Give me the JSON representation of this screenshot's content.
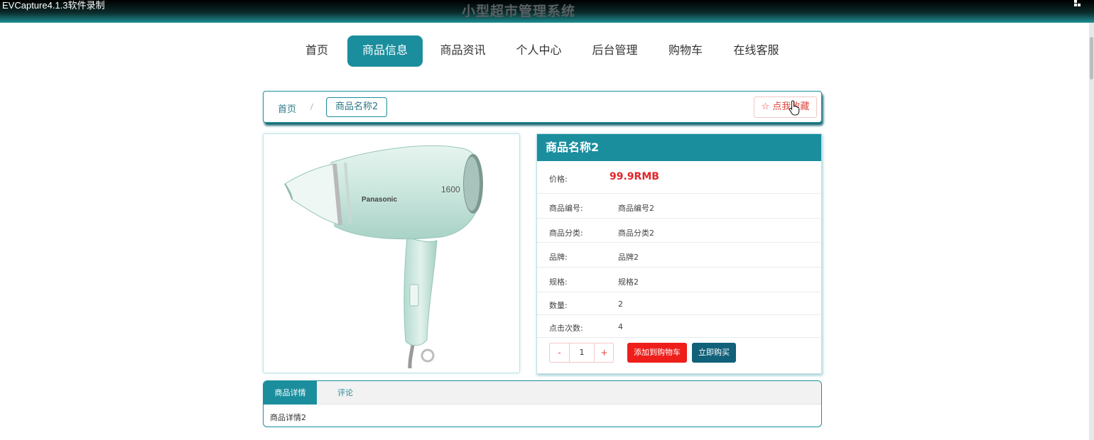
{
  "window": {
    "recorder_label": "EVCapture4.1.3软件录制",
    "system_title": "小型超市管理系统"
  },
  "nav": {
    "items": [
      {
        "label": "首页",
        "active": false
      },
      {
        "label": "商品信息",
        "active": true
      },
      {
        "label": "商品资讯",
        "active": false
      },
      {
        "label": "个人中心",
        "active": false
      },
      {
        "label": "后台管理",
        "active": false
      },
      {
        "label": "购物车",
        "active": false
      },
      {
        "label": "在线客服",
        "active": false
      }
    ]
  },
  "breadcrumb": {
    "home": "首页",
    "separator": "/",
    "current": "商品名称2",
    "favorite_label": "☆ 点我收藏"
  },
  "product": {
    "image_alt": "Panasonic hair dryer",
    "image_brand_text": "Panasonic",
    "image_power_text": "1600",
    "name": "商品名称2",
    "price_label": "价格:",
    "price_value": "99.9RMB",
    "fields": [
      {
        "key": "商品编号:",
        "value": "商品编号2"
      },
      {
        "key": "商品分类:",
        "value": "商品分类2"
      },
      {
        "key": "品牌:",
        "value": "品牌2"
      },
      {
        "key": "规格:",
        "value": "规格2"
      },
      {
        "key": "数量:",
        "value": "2"
      },
      {
        "key": "点击次数:",
        "value": "4"
      }
    ],
    "quantity": {
      "minus": "-",
      "value": "1",
      "plus": "+"
    },
    "add_to_cart_label": "添加到购物车",
    "buy_now_label": "立即购买"
  },
  "tabs": {
    "items": [
      {
        "label": "商品详情",
        "active": true
      },
      {
        "label": "评论",
        "active": false
      }
    ],
    "content": "商品详情2"
  },
  "colors": {
    "accent": "#1b8e9e",
    "price": "#e0262a",
    "add_to_cart": "#ee1e1a",
    "buy_now": "#12617a"
  }
}
